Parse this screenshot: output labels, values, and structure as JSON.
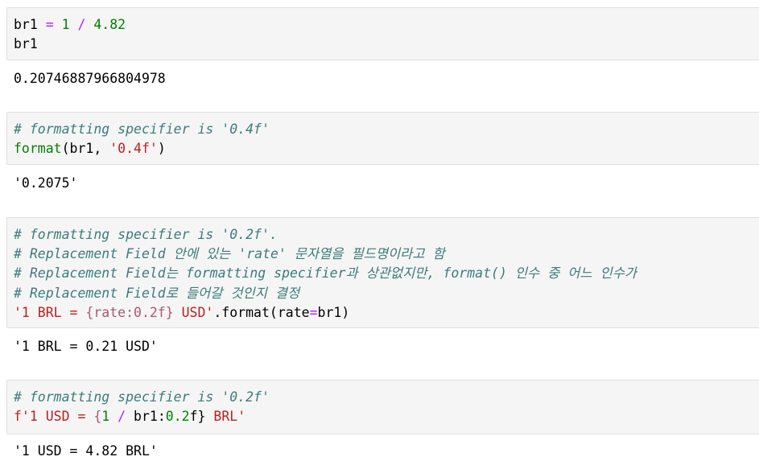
{
  "cells": [
    {
      "id": "cell1",
      "lines": [
        [
          [
            "n",
            "br1 "
          ],
          [
            "o",
            "="
          ],
          [
            "n",
            " "
          ],
          [
            "m",
            "1"
          ],
          [
            "n",
            " "
          ],
          [
            "o",
            "/"
          ],
          [
            "n",
            " "
          ],
          [
            "m",
            "4.82"
          ]
        ],
        [
          [
            "n",
            "br1"
          ]
        ]
      ],
      "output": "0.20746887966804978"
    },
    {
      "id": "cell2",
      "lines": [
        [
          [
            "c",
            "# formatting specifier is '0.4f'"
          ]
        ],
        [
          [
            "b",
            "format"
          ],
          [
            "n",
            "(br1, "
          ],
          [
            "s",
            "'0.4f'"
          ],
          [
            "n",
            ")"
          ]
        ]
      ],
      "output": "'0.2075'"
    },
    {
      "id": "cell3",
      "lines": [
        [
          [
            "c",
            "# formatting specifier is '0.2f'."
          ]
        ],
        [
          [
            "c",
            "# Replacement Field 안에 있는 'rate' 문자열을 필드명이라고 함"
          ]
        ],
        [
          [
            "c",
            "# Replacement Field는 formatting specifier과 상관없지만, format() 인수 중 어느 인수가"
          ]
        ],
        [
          [
            "c",
            "# Replacement Field로 들어갈 것인지 결정"
          ]
        ],
        [
          [
            "s",
            "'1 BRL = "
          ],
          [
            "i",
            "{rate:0.2f}"
          ],
          [
            "s",
            " USD'"
          ],
          [
            "n",
            ".format(rate"
          ],
          [
            "o",
            "="
          ],
          [
            "n",
            "br1)"
          ]
        ]
      ],
      "output": "'1 BRL = 0.21 USD'"
    },
    {
      "id": "cell4",
      "lines": [
        [
          [
            "c",
            "# formatting specifier is '0.2f'"
          ]
        ],
        [
          [
            "s",
            "f'1 USD = "
          ],
          [
            "i",
            "{"
          ],
          [
            "m",
            "1"
          ],
          [
            "n",
            " "
          ],
          [
            "o",
            "/"
          ],
          [
            "n",
            " br1:"
          ],
          [
            "m",
            "0.2"
          ],
          [
            "n",
            "f} "
          ],
          [
            "s",
            "BRL'"
          ]
        ]
      ],
      "output": "'1 USD = 4.82 BRL'"
    }
  ]
}
